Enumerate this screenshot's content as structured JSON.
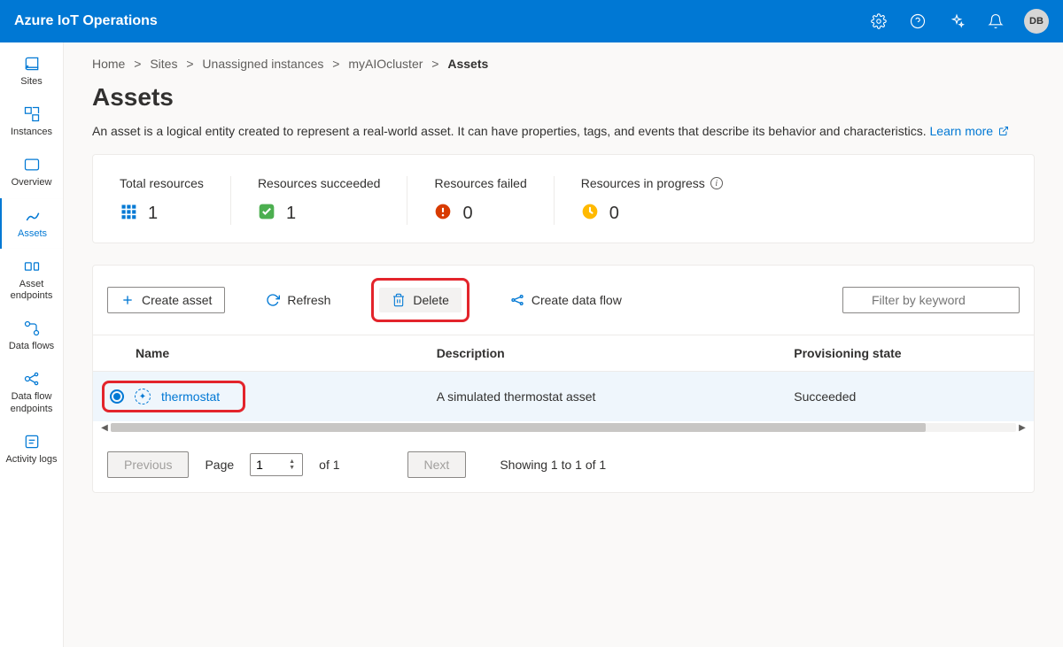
{
  "header": {
    "title": "Azure IoT Operations",
    "avatar_initials": "DB"
  },
  "sidebar": {
    "items": [
      {
        "label": "Sites"
      },
      {
        "label": "Instances"
      },
      {
        "label": "Overview"
      },
      {
        "label": "Assets"
      },
      {
        "label": "Asset endpoints"
      },
      {
        "label": "Data flows"
      },
      {
        "label": "Data flow endpoints"
      },
      {
        "label": "Activity logs"
      }
    ]
  },
  "breadcrumb": {
    "items": [
      "Home",
      "Sites",
      "Unassigned instances",
      "myAIOcluster"
    ],
    "current": "Assets",
    "sep": ">"
  },
  "page": {
    "title": "Assets",
    "description": "An asset is a logical entity created to represent a real-world asset. It can have properties, tags, and events that describe its behavior and characteristics.",
    "learn_more": "Learn more"
  },
  "stats": {
    "total_label": "Total resources",
    "total_value": "1",
    "succeeded_label": "Resources succeeded",
    "succeeded_value": "1",
    "failed_label": "Resources failed",
    "failed_value": "0",
    "inprogress_label": "Resources in progress",
    "inprogress_value": "0"
  },
  "toolbar": {
    "create_label": "Create asset",
    "refresh_label": "Refresh",
    "delete_label": "Delete",
    "dataflow_label": "Create data flow",
    "filter_placeholder": "Filter by keyword"
  },
  "table": {
    "headers": {
      "name": "Name",
      "description": "Description",
      "state": "Provisioning state"
    },
    "rows": [
      {
        "name": "thermostat",
        "description": "A simulated thermostat asset",
        "state": "Succeeded",
        "selected": true
      }
    ]
  },
  "pagination": {
    "previous": "Previous",
    "next": "Next",
    "page_label": "Page",
    "page_value": "1",
    "of_label": "of 1",
    "showing": "Showing 1 to 1 of 1"
  }
}
